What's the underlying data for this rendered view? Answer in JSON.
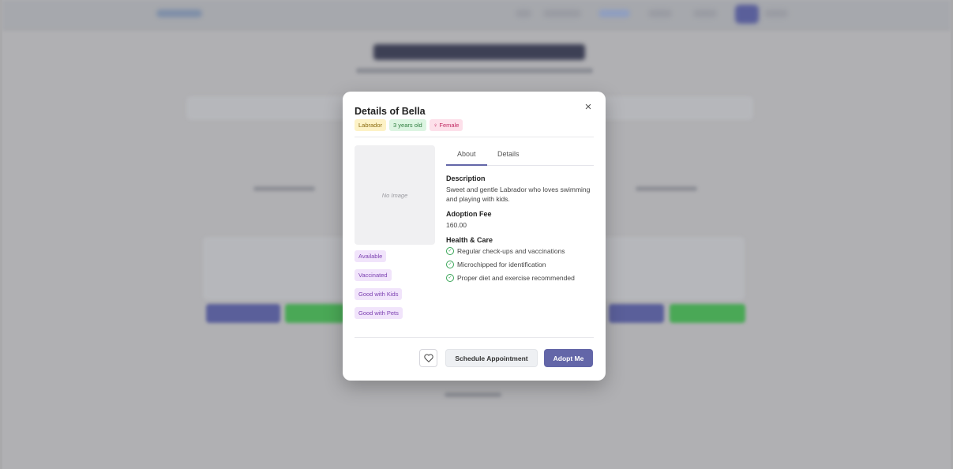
{
  "modal": {
    "title": "Details of Bella",
    "close_icon": "×",
    "badges": {
      "breed": "Labrador",
      "age": "3 years old",
      "gender": "♀ Female"
    },
    "image_placeholder": "No Image",
    "tags": [
      "Available",
      "Vaccinated",
      "Good with Kids",
      "Good with Pets"
    ],
    "tabs": [
      {
        "label": "About",
        "active": true
      },
      {
        "label": "Details",
        "active": false
      }
    ],
    "about": {
      "description_heading": "Description",
      "description": "Sweet and gentle Labrador who loves swimming and playing with kids.",
      "fee_heading": "Adoption Fee",
      "fee": "160.00",
      "health_heading": "Health & Care",
      "health_items": [
        "Regular check-ups and vaccinations",
        "Microchipped for identification",
        "Proper diet and exercise recommended"
      ]
    },
    "actions": {
      "favorite_icon": "heart-icon",
      "schedule_label": "Schedule Appointment",
      "adopt_label": "Adopt Me"
    }
  },
  "colors": {
    "accent": "#6366a8",
    "success": "#3aa658",
    "overlay": "#a9a9ab"
  }
}
